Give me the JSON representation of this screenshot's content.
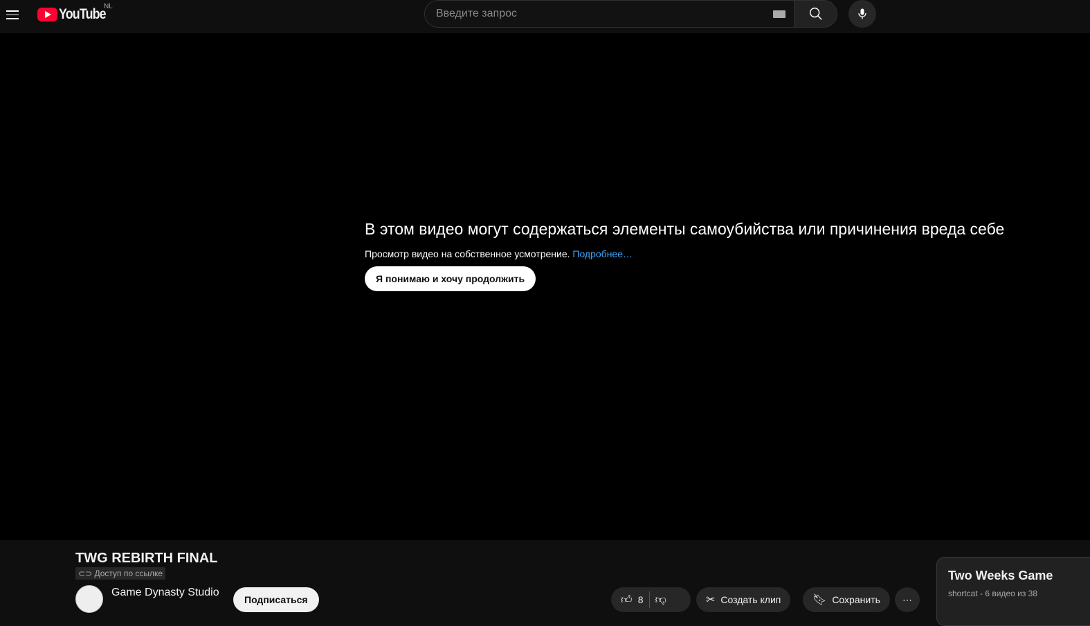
{
  "header": {
    "logo_text": "YouTube",
    "region": "NL",
    "search_placeholder": "Введите запрос"
  },
  "player": {
    "warning_title": "В этом видео могут содержаться элементы самоубийства или причинения вреда себе",
    "warning_text": "Просмотр видео на собственное усмотрение.",
    "learn_more": "Подробнее…",
    "continue_label": "Я понимаю и хочу продолжить"
  },
  "video": {
    "title": "TWG REBIRTH FINAL",
    "visibility": "Доступ по ссылке",
    "channel": "Game Dynasty Studio",
    "subscribe": "Подписаться",
    "likes": "8",
    "clip": "Создать клип",
    "save": "Сохранить",
    "more": "⋯"
  },
  "playlist": {
    "title": "Two Weeks Game",
    "meta": "shortcat - 6 видео из 38"
  }
}
